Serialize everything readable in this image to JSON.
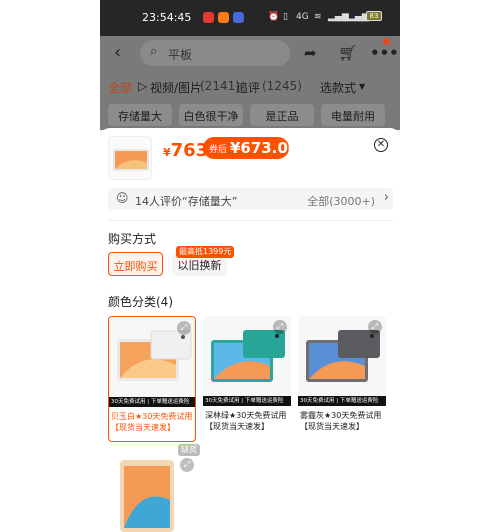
{
  "status_bar": {
    "time": "23:54:45",
    "battery": "83",
    "network": "4G"
  },
  "nav": {
    "search_placeholder": "平板"
  },
  "filter_tabs": [
    "全部",
    "视频/图片",
    "(2141)",
    "追评",
    "(1245)",
    "选款式"
  ],
  "chips": [
    "存储量大",
    "白色很干净",
    "是正品",
    "电量耐用"
  ],
  "product": {
    "price_symbol": "¥",
    "price": "763",
    "coupon_tag": "券后",
    "coupon_price": "¥673.00"
  },
  "review": {
    "text": "14人评价“存储量大”",
    "all": "全部(3000+)"
  },
  "purchase": {
    "title": "购买方式",
    "buy_now": "立即购买",
    "trade_in": "以旧换新",
    "trade_badge": "最高抵1399元"
  },
  "colors": {
    "title": "颜色分类(4)",
    "strip_text": "30天免费试用 | 下单赠送运费险",
    "items": [
      {
        "label": "贝玉白★30天免费试用【现货当天速发】",
        "selected": true
      },
      {
        "label": "深林绿★30天免费试用【现货当天速发】",
        "selected": false
      },
      {
        "label": "雾霾灰★30天免费试用【现货当天速发】",
        "selected": false
      }
    ],
    "stock_tag": "缺货"
  },
  "accent_color": "#ff5000"
}
